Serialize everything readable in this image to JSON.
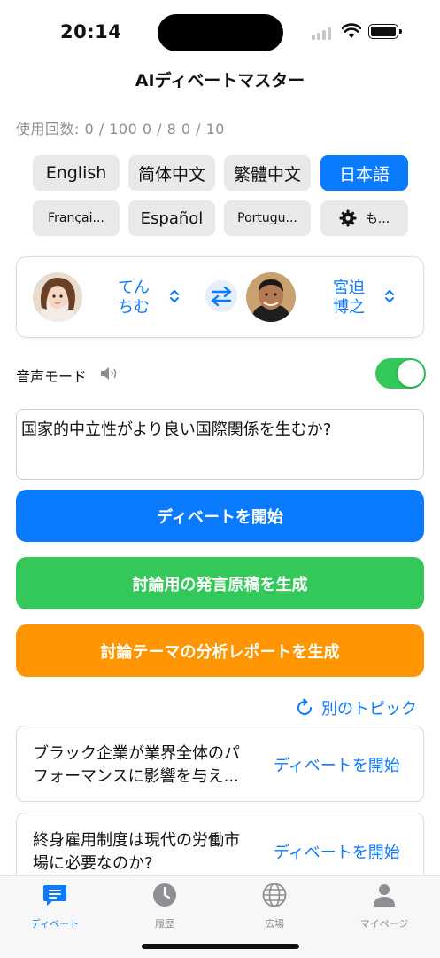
{
  "status": {
    "time": "20:14"
  },
  "app": {
    "title": "AIディベートマスター"
  },
  "usage": {
    "text": "使用回数:  0  /  100    0  /  8  0  /  10"
  },
  "languages": [
    {
      "label": "English"
    },
    {
      "label": "简体中文"
    },
    {
      "label": "繁體中文"
    },
    {
      "label": "日本語",
      "selected": true
    },
    {
      "label": "Françai..."
    },
    {
      "label": "Español"
    },
    {
      "label": "Portugu..."
    },
    {
      "label": "も...",
      "icon": "gear-icon"
    }
  ],
  "debaters": {
    "left": {
      "name_line1": "てん",
      "name_line2": "ちむ"
    },
    "right": {
      "name_line1": "宮迫",
      "name_line2": "博之"
    }
  },
  "voice_mode": {
    "label": "音声モード",
    "enabled": true
  },
  "topic_input": {
    "value": "国家的中立性がより良い国際関係を生むか?"
  },
  "actions": {
    "start": "ディベートを開始",
    "script": "討論用の発言原稿を生成",
    "report": "討論テーマの分析レポートを生成"
  },
  "refresh_label": "別のトピック",
  "suggestions": [
    {
      "line1": "ブラック企業が業界全体のパ",
      "line2": "フォーマンスに影響を与え...",
      "start": "ディベートを開始"
    },
    {
      "line1": "終身雇用制度は現代の労働市",
      "line2": "場に必要なのか?",
      "start": "ディベートを開始"
    }
  ],
  "tabs": [
    {
      "label": "ディベート",
      "icon": "chat-icon",
      "active": true
    },
    {
      "label": "履歴",
      "icon": "clock-icon"
    },
    {
      "label": "広場",
      "icon": "globe-icon"
    },
    {
      "label": "マイページ",
      "icon": "person-icon"
    }
  ],
  "colors": {
    "accent": "#0a7aff",
    "green": "#34c759",
    "orange": "#ff9500"
  }
}
